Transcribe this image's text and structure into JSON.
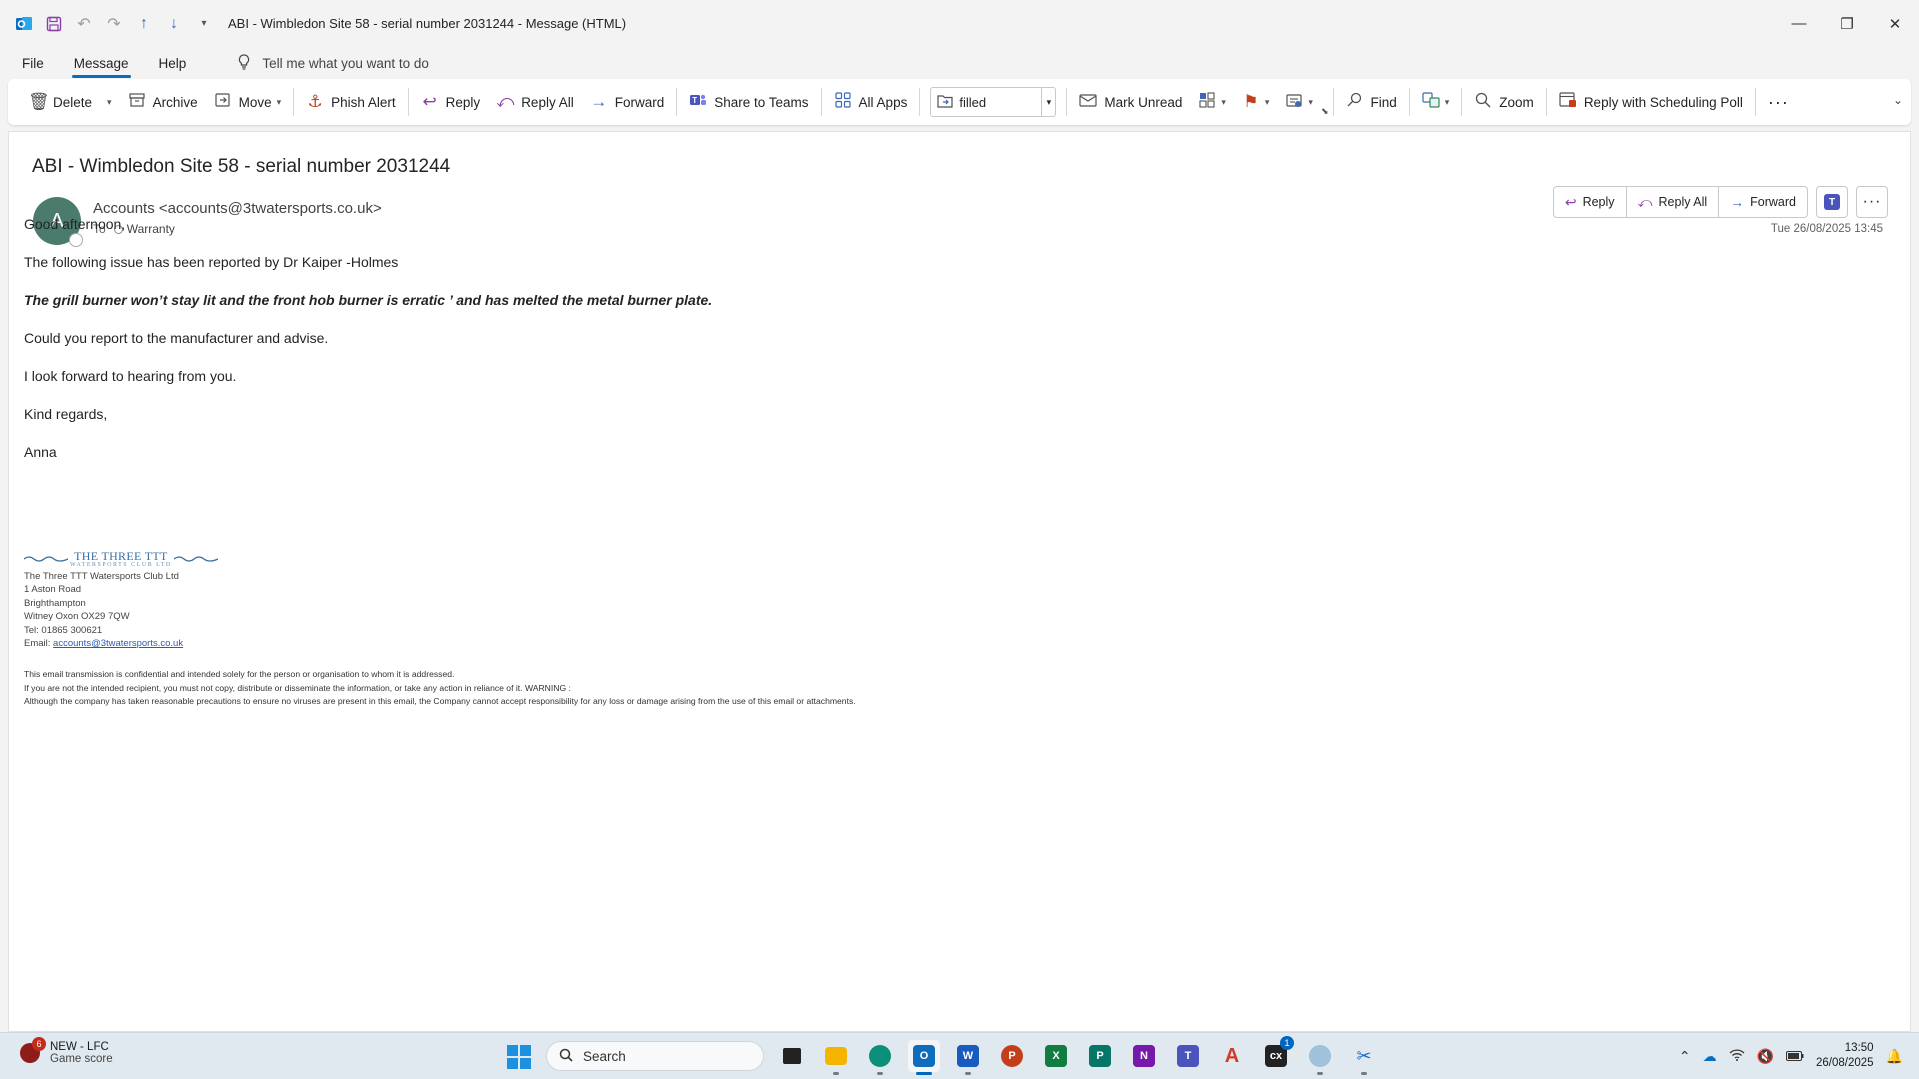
{
  "window": {
    "title": "ABI - Wimbledon  Site 58  - serial number  2031244  -  Message (HTML)",
    "controls": {
      "minimize": "—",
      "restore": "❐",
      "close": "✕"
    }
  },
  "menu": {
    "tabs": [
      "File",
      "Message",
      "Help"
    ],
    "active_tab": "Message",
    "tell_me": "Tell me what you want to do"
  },
  "ribbon": {
    "delete": "Delete",
    "archive": "Archive",
    "move": "Move",
    "phish_alert": "Phish Alert",
    "reply": "Reply",
    "reply_all": "Reply All",
    "forward": "Forward",
    "share_teams": "Share to Teams",
    "all_apps": "All Apps",
    "quick_step": "filled",
    "mark_unread": "Mark Unread",
    "find": "Find",
    "zoom": "Zoom",
    "scheduling_poll": "Reply with Scheduling Poll"
  },
  "message": {
    "subject": "ABI - Wimbledon  Site 58  - serial number   2031244",
    "avatar_initial": "A",
    "sender": "Accounts <accounts@3twatersports.co.uk>",
    "to_label": "To",
    "recipient": "Warranty",
    "date": "Tue 26/08/2025 13:45",
    "actions": {
      "reply": "Reply",
      "reply_all": "Reply All",
      "forward": "Forward"
    },
    "body": {
      "greeting": "Good afternoon,",
      "line1": "The following issue has been reported by Dr Kaiper -Holmes",
      "issue": "The grill burner won’t stay lit and the front hob burner is erratic ’ and has melted the metal burner plate.",
      "line2": "Could you report to the manufacturer and advise.",
      "line3": "I look forward to hearing from you.",
      "closing": "Kind regards,",
      "name": "Anna"
    },
    "signature": {
      "logo_line1": "THE THREE TTT",
      "logo_line2": "WATERSPORTS CLUB LTD",
      "company": "The Three TTT Watersports Club Ltd",
      "address1": "1 Aston Road",
      "address2": "Brighthampton",
      "address3": "Witney Oxon OX29 7QW",
      "tel": "Tel: 01865 300621",
      "email_label": "Email: ",
      "email": "accounts@3twatersports.co.uk"
    },
    "disclaimer": {
      "line1": "This email transmission is confidential and intended solely for the person or organisation to whom it is addressed.",
      "line2": "If you are not the intended recipient, you must not copy, distribute or disseminate the information, or take any action in reliance of it. WARNING :",
      "line3": "Although the company has taken reasonable precautions to ensure no viruses are present in this email, the Company cannot accept responsibility for any loss or damage arising from the use of this email or attachments."
    }
  },
  "taskbar": {
    "widget_title": "NEW - LFC",
    "widget_subtitle": "Game score",
    "widget_badge": "6",
    "search_placeholder": "Search",
    "app_badge": "1",
    "time": "13:50",
    "date": "26/08/2025"
  }
}
